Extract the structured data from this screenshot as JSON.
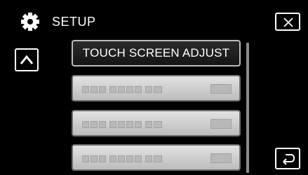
{
  "header": {
    "title": "SETUP",
    "icon": "gear-icon"
  },
  "buttons": {
    "close_icon": "close-icon",
    "up_icon": "chevron-up-icon",
    "back_icon": "return-icon"
  },
  "menu": {
    "items": [
      {
        "label": "TOUCH SCREEN ADJUST",
        "selected": true
      },
      {
        "label": "",
        "selected": false
      },
      {
        "label": "",
        "selected": false
      },
      {
        "label": "",
        "selected": false
      }
    ]
  },
  "colors": {
    "background": "#000000",
    "selected_item": "#1e1e1e",
    "unselected_item": "#cfcfcf",
    "text": "#ffffff"
  }
}
